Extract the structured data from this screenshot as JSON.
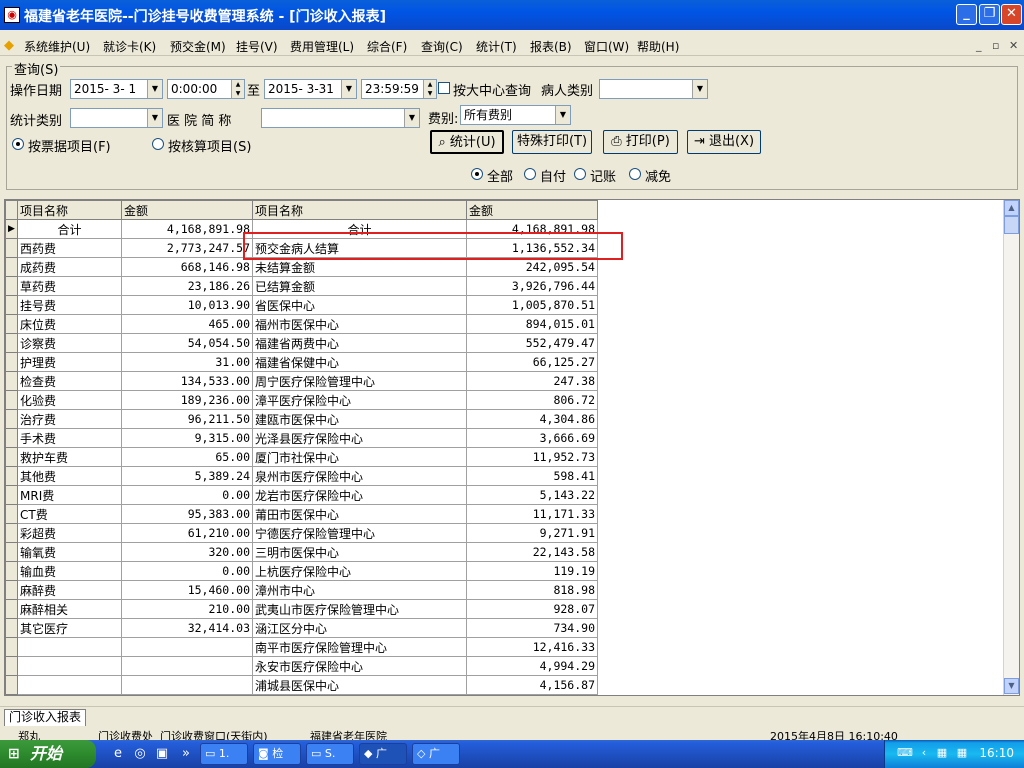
{
  "window": {
    "title": "福建省老年医院--门诊挂号收费管理系统 - [门诊收入报表]",
    "controls": {
      "minimize": "_",
      "restore": "❐",
      "close": "✕"
    }
  },
  "menu": {
    "items": [
      "系统维护(U)",
      "就诊卡(K)",
      "预交金(M)",
      "挂号(V)",
      "费用管理(L)",
      "综合(F)",
      "查询(C)",
      "统计(T)",
      "报表(B)",
      "窗口(W)",
      "帮助(H)"
    ],
    "mdi_controls": [
      "_",
      "▫",
      "✕"
    ]
  },
  "query": {
    "group_title": "查询(S)",
    "op_date_label": "操作日期",
    "date_from": "2015- 3- 1",
    "time_from": "0:00:00",
    "to_label": "至",
    "date_to": "2015- 3-31",
    "time_to": "23:59:59",
    "center_query_label": "按大中心查询",
    "patient_type_label": "病人类别",
    "patient_type_value": "",
    "stat_category_label": "统计类别",
    "stat_category_value": "",
    "hospital_abbr_label": "医 院 简 称",
    "hospital_abbr_value": "",
    "fee_type_label": "费别:",
    "fee_type_value": "所有费别",
    "radio_by_receipt": "按票据项目(F)",
    "radio_by_settlement": "按核算项目(S)",
    "btn_stat": "统计(U)",
    "btn_special_print": "特殊打印(T)",
    "btn_print": "打印(P)",
    "btn_exit": "退出(X)",
    "filter_all": "全部",
    "filter_self_pay": "自付",
    "filter_account": "记账",
    "filter_waive": "减免"
  },
  "table": {
    "headers": [
      "项目名称",
      "金额",
      "项目名称",
      "金额"
    ],
    "rows": [
      [
        "合计",
        "4,168,891.98",
        "合计",
        "4,168,891.98"
      ],
      [
        "西药费",
        "2,773,247.57",
        "预交金病人结算",
        "1,136,552.34"
      ],
      [
        "成药费",
        "668,146.98",
        "未结算金额",
        "242,095.54"
      ],
      [
        "草药费",
        "23,186.26",
        "已结算金额",
        "3,926,796.44"
      ],
      [
        "挂号费",
        "10,013.90",
        "省医保中心",
        "1,005,870.51"
      ],
      [
        "床位费",
        "465.00",
        "福州市医保中心",
        "894,015.01"
      ],
      [
        "诊察费",
        "54,054.50",
        "福建省两费中心",
        "552,479.47"
      ],
      [
        "护理费",
        "31.00",
        "福建省保健中心",
        "66,125.27"
      ],
      [
        "检查费",
        "134,533.00",
        "周宁医疗保险管理中心",
        "247.38"
      ],
      [
        "化验费",
        "189,236.00",
        "漳平医疗保险中心",
        "806.72"
      ],
      [
        "治疗费",
        "96,211.50",
        "建瓯市医保中心",
        "4,304.86"
      ],
      [
        "手术费",
        "9,315.00",
        "光泽县医疗保险中心",
        "3,666.69"
      ],
      [
        "救护车费",
        "65.00",
        "厦门市社保中心",
        "11,952.73"
      ],
      [
        "其他费",
        "5,389.24",
        "泉州市医疗保险中心",
        "598.41"
      ],
      [
        "MRI费",
        "0.00",
        "龙岩市医疗保险中心",
        "5,143.22"
      ],
      [
        "CT费",
        "95,383.00",
        "莆田市医保中心",
        "11,171.33"
      ],
      [
        "彩超费",
        "61,210.00",
        "宁德医疗保险管理中心",
        "9,271.91"
      ],
      [
        "输氧费",
        "320.00",
        "三明市医保中心",
        "22,143.58"
      ],
      [
        "输血费",
        "0.00",
        "上杭医疗保险中心",
        "119.19"
      ],
      [
        "麻醉费",
        "15,460.00",
        "漳州市中心",
        "818.98"
      ],
      [
        "麻醉相关",
        "210.00",
        "武夷山市医疗保险管理中心",
        "928.07"
      ],
      [
        "其它医疗",
        "32,414.03",
        "涵江区分中心",
        "734.90"
      ],
      [
        "",
        "",
        "南平市医疗保险管理中心",
        "12,416.33"
      ],
      [
        "",
        "",
        "永安市医疗保险中心",
        "4,994.29"
      ],
      [
        "",
        "",
        "浦城县医保中心",
        "4,156.87"
      ]
    ]
  },
  "status": {
    "tab": "门诊收入报表",
    "bottom_items": [
      "郑丸",
      "门诊收费处",
      "门诊收费窗口(天街内)",
      "福建省老年医院",
      "2015年4月8日 16:10:40"
    ]
  },
  "taskbar": {
    "start": "开始",
    "items": [
      "1.",
      "检",
      "S.",
      "广",
      "广"
    ],
    "chevron": "»",
    "clock": "16:10"
  },
  "colors": {
    "highlight_border": "#e02020",
    "titlebar": "#0055e5",
    "taskbar": "#245edb",
    "start_button": "#2d8a2d"
  }
}
